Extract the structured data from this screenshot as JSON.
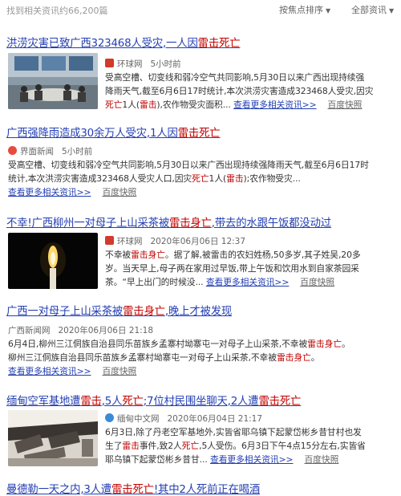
{
  "topbar": {
    "count": "找到相关资讯约66,200篇",
    "sort_label": "按焦点排序",
    "filter_label": "全部资讯"
  },
  "results": [
    {
      "title_a": "洪涝灾害已致广西323468人受灾,一人因",
      "title_hl": "雷击死亡",
      "title_b": "",
      "source": "环球网",
      "time": "5小时前",
      "line1": "受高空槽、切变线和弱冷空气共同影响,5月30日以来广西出现持续强",
      "line2": "降雨天气,截至6月6日17时统计,本次洪涝灾害造成323468人受灾,因灾",
      "line3_hl": "死亡",
      "line3_a": "1人(",
      "line3_hl2": "雷击",
      "line3_b": "),农作物受灾面积...",
      "more": "查看更多相关资讯>>",
      "snap": "百度快照"
    },
    {
      "title_a": "广西强降雨造成30余万人受灾,1人因",
      "title_hl": "雷击死亡",
      "title_b": "",
      "source": "界面新闻",
      "time": "5小时前",
      "line1": "受高空槽、切变线和弱冷空气共同影响,5月30日以来广西出现持续强降雨天气,截至6月6日17时",
      "line2_a": "统计,本次洪涝灾害造成323468人受灾人口,因灾",
      "line2_hl": "死亡",
      "line2_b": "1人(",
      "line2_hl2": "雷击",
      "line2_c": ");农作物受灾...",
      "more": "查看更多相关资讯>>",
      "snap": "百度快照"
    },
    {
      "title_a": "不幸!广西柳州一对母子上山采茶被",
      "title_hl": "雷击身亡",
      "title_b": ",带去的水跟午饭都没动过",
      "source": "环球网",
      "time": "2020年06月06日 12:37",
      "line1_a": "不幸被",
      "line1_hl": "雷击身亡",
      "line1_b": "。据了解,被雷击的农妇姓杨,50多岁,其子姓吴,20多",
      "line2": "岁。当天早上,母子两在家用过早饭,带上午饭和饮用水到自家茶园采",
      "line3": "茶。“早上出门的时候没...",
      "more": "查看更多相关资讯>>",
      "snap": "百度快照"
    },
    {
      "title_a": "广西一对母子上山采茶被",
      "title_hl": "雷击身亡",
      "title_b": ",晚上才被发现",
      "source": "广西新闻网",
      "time": "2020年06月06日 21:18",
      "line1_a": "6月4日,柳州三江侗族自治县同乐苗族乡孟寨村坳寨屯一对母子上山采茶,不幸被",
      "line1_hl": "雷击身亡",
      "line1_b": "。",
      "line2_a": "柳州三江侗族自治县同乐苗族乡孟寨村坳寨屯一对母子上山采茶,不幸被",
      "line2_hl": "雷击身亡",
      "line2_b": "。",
      "more": "查看更多相关资讯>>",
      "snap": "百度快照"
    },
    {
      "title_a": "缅甸空军基地遭",
      "title_hl": "雷击",
      "title_b": ",5人",
      "title_hl2": "死亡",
      "title_c": ";7位村民围坐聊天,2人遭",
      "title_hl3": "雷击死亡",
      "source": "缅甸中文网",
      "time": "2020年06月04日 21:17",
      "line1": "6月3日,除了丹老空军基地外,实皆省耶乌镇下起蒙岱彬乡昔甘村也发",
      "line2_a": "生了",
      "line2_hl": "雷击",
      "line2_b": "事件,致2人",
      "line2_hl2": "死亡",
      "line2_c": ",5人受伤。6月3日下午4点15分左右,实皆省",
      "line3": "耶乌镇下起蒙岱彬乡昔甘...",
      "more": "查看更多相关资讯>>",
      "snap": "百度快照"
    },
    {
      "title_a": "曼德勒一天之内,3人遭",
      "title_hl": "雷击死亡",
      "title_b": "!其中2人死前正在喝酒"
    }
  ],
  "colors": {
    "link": "#2440b3",
    "highlight": "#c00000",
    "meta": "#666666"
  }
}
